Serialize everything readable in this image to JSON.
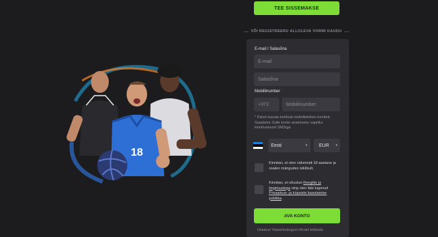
{
  "deposit_button": "TEE SISSEMAKSE",
  "divider_text": "VÕI REGISTREERU ALLOLEVA VORMI KAUDU",
  "form": {
    "email_password_label": "E-mail / Salasõna",
    "email_placeholder": "E-mail",
    "password_placeholder": "Salasõna",
    "mobile_label": "Mobiilinumber",
    "country_code": "+372",
    "mobile_placeholder": "Mobiilinumber",
    "note": "* Palun kasuta kehtivat mobiiltelefoni numbrit. Saadame Sulle konto avamiseks vajaliku kinnituskoodi SMSiga",
    "country": "Eesti",
    "currency": "EUR",
    "flag_colors": [
      "#1e7fd8",
      "#000000",
      "#ffffff"
    ],
    "consent_age": "Kinnitan, et olen vähemalt 18 aastane ja osalen mängudes isiklikult.",
    "consent_terms_prefix": "Kinnitan, et nõustun ",
    "consent_terms_link": "Reeglite ja tingimustega",
    "consent_terms_mid": " ning olen läbi lugenud ",
    "consent_privacy_link": "Privaatsus- ja küpsiste kasutamise poliitika",
    "consent_terms_suffix": ".",
    "open_account_button": "AVA KONTO",
    "warning": "Hoiatus! Hasartmängud võivad tekitada"
  },
  "hero": {
    "jersey_number": "18"
  },
  "colors": {
    "accent": "#7ddc36",
    "background": "#1c1c1f",
    "panel": "#2c2c31",
    "field": "#3a3a40"
  }
}
